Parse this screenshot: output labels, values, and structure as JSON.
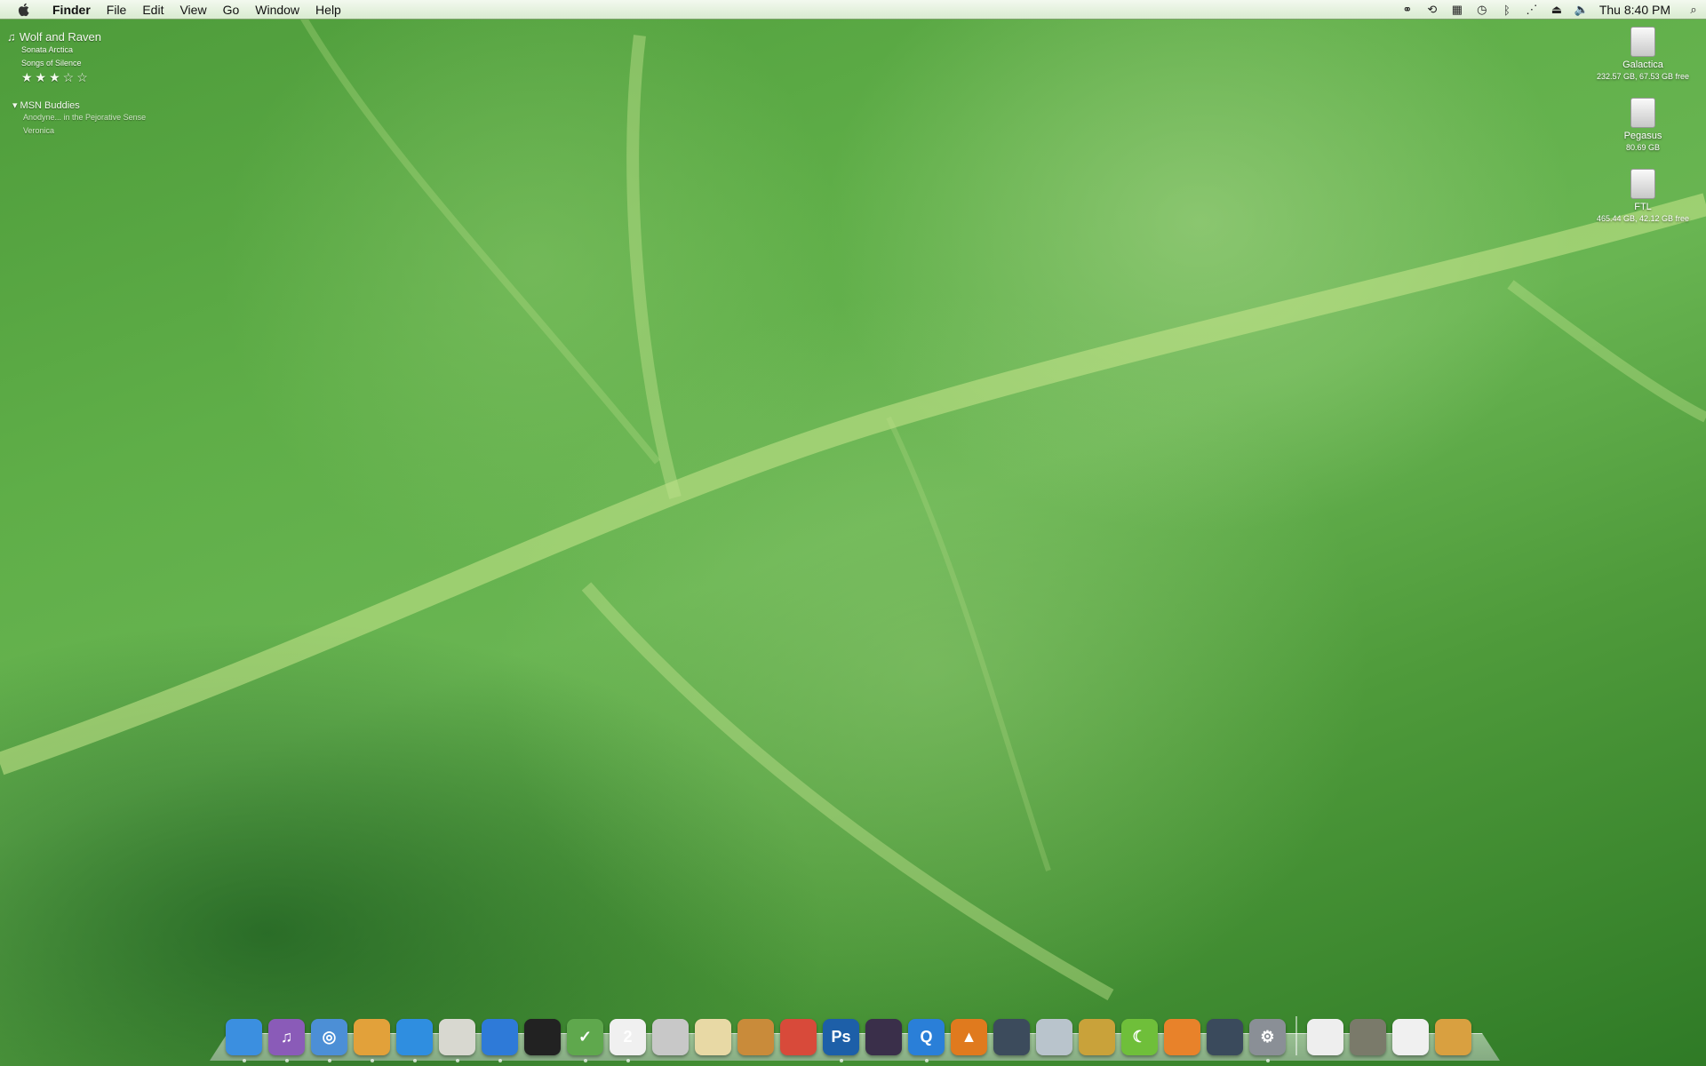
{
  "menubar": {
    "app_name": "Finder",
    "menus": [
      "File",
      "Edit",
      "View",
      "Go",
      "Window",
      "Help"
    ],
    "clock": "Thu 8:40 PM",
    "status_icons": [
      "users-icon",
      "sync-icon",
      "spaces-icon",
      "time-machine-icon",
      "bluetooth-icon",
      "wifi-icon",
      "eject-icon",
      "volume-icon"
    ]
  },
  "now_playing": {
    "song": "Wolf and Raven",
    "artist": "Sonata Arctica",
    "album": "Songs of Silence",
    "rating_stars": "★★★☆☆",
    "rating": 3
  },
  "buddies": {
    "group": "MSN Buddies",
    "items": [
      "Anodyne... in the Pejorative Sense",
      "Veronica"
    ]
  },
  "drives": [
    {
      "name": "Galactica",
      "info": "232.57 GB, 67.53 GB free"
    },
    {
      "name": "Pegasus",
      "info": "80.69 GB"
    },
    {
      "name": "FTL",
      "info": "465.44 GB, 42.12 GB free"
    }
  ],
  "dock": {
    "apps": [
      {
        "icon": "finder-icon",
        "label": "",
        "color": "#3b8fe0"
      },
      {
        "icon": "itunes-icon",
        "label": "♫",
        "color": "#8a5bb8"
      },
      {
        "icon": "safari-icon",
        "label": "◎",
        "color": "#4c8fd6"
      },
      {
        "icon": "notes-icon",
        "label": "",
        "color": "#e2a13a"
      },
      {
        "icon": "ichat-icon",
        "label": "",
        "color": "#2f8ee0"
      },
      {
        "icon": "newsfire-icon",
        "label": "",
        "color": "#d8d8d0"
      },
      {
        "icon": "globe-icon",
        "label": "",
        "color": "#2e7ad8"
      },
      {
        "icon": "terminal-icon",
        "label": "",
        "color": "#222222"
      },
      {
        "icon": "todo-icon",
        "label": "✓",
        "color": "#5fa84d"
      },
      {
        "icon": "ical-icon",
        "label": "2",
        "color": "#f0f0f0"
      },
      {
        "icon": "cherries-icon",
        "label": "",
        "color": "#c8c8c8"
      },
      {
        "icon": "textedit-icon",
        "label": "",
        "color": "#e8d9a5"
      },
      {
        "icon": "coffee-icon",
        "label": "",
        "color": "#c98b3a"
      },
      {
        "icon": "cssedit-icon",
        "label": "",
        "color": "#d84a3a"
      },
      {
        "icon": "photoshop-icon",
        "label": "Ps",
        "color": "#1d5fa8"
      },
      {
        "icon": "camera-icon",
        "label": "",
        "color": "#3a2f4a"
      },
      {
        "icon": "quicktime-icon",
        "label": "Q",
        "color": "#2a7fd8"
      },
      {
        "icon": "vlc-icon",
        "label": "▲",
        "color": "#e07a1e"
      },
      {
        "icon": "installer-icon",
        "label": "",
        "color": "#3c4b5c"
      },
      {
        "icon": "scanner-icon",
        "label": "",
        "color": "#b9c4cc"
      },
      {
        "icon": "transmit-icon",
        "label": "",
        "color": "#c9a23a"
      },
      {
        "icon": "moon-icon",
        "label": "☾",
        "color": "#6fbf3a"
      },
      {
        "icon": "firefox-icon",
        "label": "",
        "color": "#e8822a"
      },
      {
        "icon": "timemachine-icon",
        "label": "",
        "color": "#3a4a5c"
      },
      {
        "icon": "systemprefs-icon",
        "label": "⚙",
        "color": "#8a8f96"
      }
    ],
    "stacks": [
      {
        "icon": "documents-stack-icon",
        "color": "#eeeeee"
      },
      {
        "icon": "pictures-stack-icon",
        "color": "#7a7a6a"
      },
      {
        "icon": "downloads-stack-icon",
        "color": "#f0f0f0"
      },
      {
        "icon": "trash-icon",
        "color": "#d9a040"
      }
    ]
  }
}
